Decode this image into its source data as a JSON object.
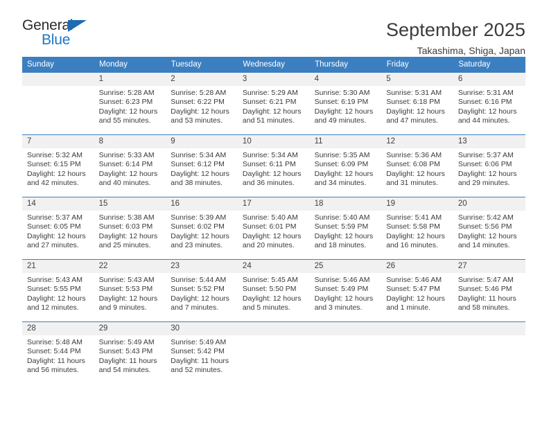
{
  "brand": {
    "name_top": "General",
    "name_bottom": "Blue",
    "accent_color": "#1b77c4",
    "triangle_icon": "triangle-icon"
  },
  "header": {
    "title": "September 2025",
    "subtitle": "Takashima, Shiga, Japan"
  },
  "calendar": {
    "header_bg": "#3c7fc1",
    "daynum_bg": "#f1f1f1",
    "weekday_headers": [
      "Sunday",
      "Monday",
      "Tuesday",
      "Wednesday",
      "Thursday",
      "Friday",
      "Saturday"
    ],
    "weeks": [
      [
        {
          "day": "",
          "sunrise": "",
          "sunset": "",
          "daylight_line1": "",
          "daylight_line2": "",
          "blank": true
        },
        {
          "day": "1",
          "sunrise": "Sunrise: 5:28 AM",
          "sunset": "Sunset: 6:23 PM",
          "daylight_line1": "Daylight: 12 hours",
          "daylight_line2": "and 55 minutes."
        },
        {
          "day": "2",
          "sunrise": "Sunrise: 5:28 AM",
          "sunset": "Sunset: 6:22 PM",
          "daylight_line1": "Daylight: 12 hours",
          "daylight_line2": "and 53 minutes."
        },
        {
          "day": "3",
          "sunrise": "Sunrise: 5:29 AM",
          "sunset": "Sunset: 6:21 PM",
          "daylight_line1": "Daylight: 12 hours",
          "daylight_line2": "and 51 minutes."
        },
        {
          "day": "4",
          "sunrise": "Sunrise: 5:30 AM",
          "sunset": "Sunset: 6:19 PM",
          "daylight_line1": "Daylight: 12 hours",
          "daylight_line2": "and 49 minutes."
        },
        {
          "day": "5",
          "sunrise": "Sunrise: 5:31 AM",
          "sunset": "Sunset: 6:18 PM",
          "daylight_line1": "Daylight: 12 hours",
          "daylight_line2": "and 47 minutes."
        },
        {
          "day": "6",
          "sunrise": "Sunrise: 5:31 AM",
          "sunset": "Sunset: 6:16 PM",
          "daylight_line1": "Daylight: 12 hours",
          "daylight_line2": "and 44 minutes."
        }
      ],
      [
        {
          "day": "7",
          "sunrise": "Sunrise: 5:32 AM",
          "sunset": "Sunset: 6:15 PM",
          "daylight_line1": "Daylight: 12 hours",
          "daylight_line2": "and 42 minutes."
        },
        {
          "day": "8",
          "sunrise": "Sunrise: 5:33 AM",
          "sunset": "Sunset: 6:14 PM",
          "daylight_line1": "Daylight: 12 hours",
          "daylight_line2": "and 40 minutes."
        },
        {
          "day": "9",
          "sunrise": "Sunrise: 5:34 AM",
          "sunset": "Sunset: 6:12 PM",
          "daylight_line1": "Daylight: 12 hours",
          "daylight_line2": "and 38 minutes."
        },
        {
          "day": "10",
          "sunrise": "Sunrise: 5:34 AM",
          "sunset": "Sunset: 6:11 PM",
          "daylight_line1": "Daylight: 12 hours",
          "daylight_line2": "and 36 minutes."
        },
        {
          "day": "11",
          "sunrise": "Sunrise: 5:35 AM",
          "sunset": "Sunset: 6:09 PM",
          "daylight_line1": "Daylight: 12 hours",
          "daylight_line2": "and 34 minutes."
        },
        {
          "day": "12",
          "sunrise": "Sunrise: 5:36 AM",
          "sunset": "Sunset: 6:08 PM",
          "daylight_line1": "Daylight: 12 hours",
          "daylight_line2": "and 31 minutes."
        },
        {
          "day": "13",
          "sunrise": "Sunrise: 5:37 AM",
          "sunset": "Sunset: 6:06 PM",
          "daylight_line1": "Daylight: 12 hours",
          "daylight_line2": "and 29 minutes."
        }
      ],
      [
        {
          "day": "14",
          "sunrise": "Sunrise: 5:37 AM",
          "sunset": "Sunset: 6:05 PM",
          "daylight_line1": "Daylight: 12 hours",
          "daylight_line2": "and 27 minutes."
        },
        {
          "day": "15",
          "sunrise": "Sunrise: 5:38 AM",
          "sunset": "Sunset: 6:03 PM",
          "daylight_line1": "Daylight: 12 hours",
          "daylight_line2": "and 25 minutes."
        },
        {
          "day": "16",
          "sunrise": "Sunrise: 5:39 AM",
          "sunset": "Sunset: 6:02 PM",
          "daylight_line1": "Daylight: 12 hours",
          "daylight_line2": "and 23 minutes."
        },
        {
          "day": "17",
          "sunrise": "Sunrise: 5:40 AM",
          "sunset": "Sunset: 6:01 PM",
          "daylight_line1": "Daylight: 12 hours",
          "daylight_line2": "and 20 minutes."
        },
        {
          "day": "18",
          "sunrise": "Sunrise: 5:40 AM",
          "sunset": "Sunset: 5:59 PM",
          "daylight_line1": "Daylight: 12 hours",
          "daylight_line2": "and 18 minutes."
        },
        {
          "day": "19",
          "sunrise": "Sunrise: 5:41 AM",
          "sunset": "Sunset: 5:58 PM",
          "daylight_line1": "Daylight: 12 hours",
          "daylight_line2": "and 16 minutes."
        },
        {
          "day": "20",
          "sunrise": "Sunrise: 5:42 AM",
          "sunset": "Sunset: 5:56 PM",
          "daylight_line1": "Daylight: 12 hours",
          "daylight_line2": "and 14 minutes."
        }
      ],
      [
        {
          "day": "21",
          "sunrise": "Sunrise: 5:43 AM",
          "sunset": "Sunset: 5:55 PM",
          "daylight_line1": "Daylight: 12 hours",
          "daylight_line2": "and 12 minutes."
        },
        {
          "day": "22",
          "sunrise": "Sunrise: 5:43 AM",
          "sunset": "Sunset: 5:53 PM",
          "daylight_line1": "Daylight: 12 hours",
          "daylight_line2": "and 9 minutes."
        },
        {
          "day": "23",
          "sunrise": "Sunrise: 5:44 AM",
          "sunset": "Sunset: 5:52 PM",
          "daylight_line1": "Daylight: 12 hours",
          "daylight_line2": "and 7 minutes."
        },
        {
          "day": "24",
          "sunrise": "Sunrise: 5:45 AM",
          "sunset": "Sunset: 5:50 PM",
          "daylight_line1": "Daylight: 12 hours",
          "daylight_line2": "and 5 minutes."
        },
        {
          "day": "25",
          "sunrise": "Sunrise: 5:46 AM",
          "sunset": "Sunset: 5:49 PM",
          "daylight_line1": "Daylight: 12 hours",
          "daylight_line2": "and 3 minutes."
        },
        {
          "day": "26",
          "sunrise": "Sunrise: 5:46 AM",
          "sunset": "Sunset: 5:47 PM",
          "daylight_line1": "Daylight: 12 hours",
          "daylight_line2": "and 1 minute."
        },
        {
          "day": "27",
          "sunrise": "Sunrise: 5:47 AM",
          "sunset": "Sunset: 5:46 PM",
          "daylight_line1": "Daylight: 11 hours",
          "daylight_line2": "and 58 minutes."
        }
      ],
      [
        {
          "day": "28",
          "sunrise": "Sunrise: 5:48 AM",
          "sunset": "Sunset: 5:44 PM",
          "daylight_line1": "Daylight: 11 hours",
          "daylight_line2": "and 56 minutes."
        },
        {
          "day": "29",
          "sunrise": "Sunrise: 5:49 AM",
          "sunset": "Sunset: 5:43 PM",
          "daylight_line1": "Daylight: 11 hours",
          "daylight_line2": "and 54 minutes."
        },
        {
          "day": "30",
          "sunrise": "Sunrise: 5:49 AM",
          "sunset": "Sunset: 5:42 PM",
          "daylight_line1": "Daylight: 11 hours",
          "daylight_line2": "and 52 minutes."
        },
        {
          "day": "",
          "sunrise": "",
          "sunset": "",
          "daylight_line1": "",
          "daylight_line2": "",
          "blank": true
        },
        {
          "day": "",
          "sunrise": "",
          "sunset": "",
          "daylight_line1": "",
          "daylight_line2": "",
          "blank": true
        },
        {
          "day": "",
          "sunrise": "",
          "sunset": "",
          "daylight_line1": "",
          "daylight_line2": "",
          "blank": true
        },
        {
          "day": "",
          "sunrise": "",
          "sunset": "",
          "daylight_line1": "",
          "daylight_line2": "",
          "blank": true
        }
      ]
    ]
  }
}
